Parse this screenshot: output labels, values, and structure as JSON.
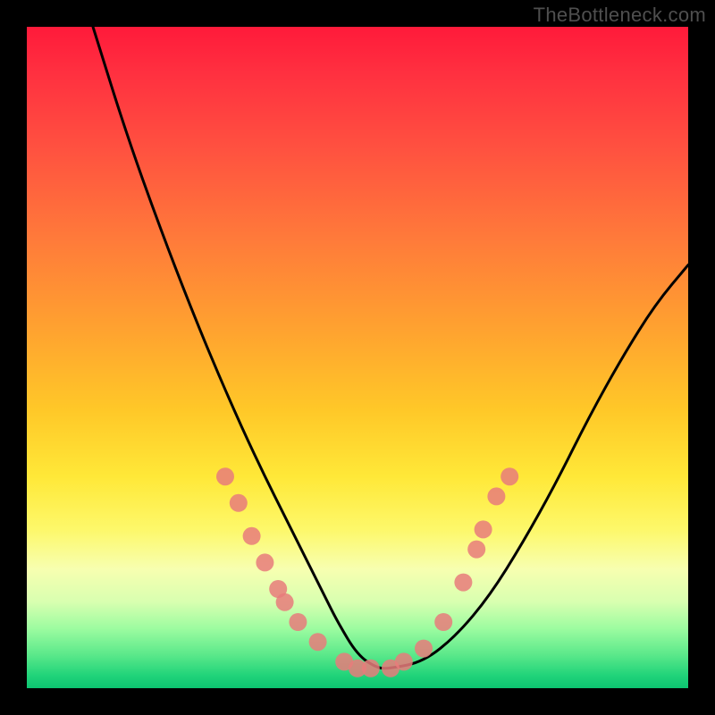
{
  "watermark": "TheBottleneck.com",
  "chart_data": {
    "type": "line",
    "title": "",
    "xlabel": "",
    "ylabel": "",
    "xlim": [
      0,
      100
    ],
    "ylim": [
      0,
      100
    ],
    "grid": false,
    "legend": false,
    "series": [
      {
        "name": "bottleneck-curve",
        "color": "#000000",
        "x": [
          10,
          15,
          20,
          25,
          30,
          35,
          40,
          45,
          47,
          50,
          53,
          55,
          60,
          65,
          70,
          75,
          80,
          85,
          90,
          95,
          100
        ],
        "y": [
          100,
          84,
          70,
          57,
          45,
          34,
          24,
          14,
          10,
          5,
          3,
          3,
          4,
          8,
          14,
          22,
          31,
          41,
          50,
          58,
          64
        ]
      }
    ],
    "markers": {
      "name": "highlighted-points",
      "color": "#e77b7b",
      "points": [
        {
          "x": 30,
          "y": 32
        },
        {
          "x": 32,
          "y": 28
        },
        {
          "x": 34,
          "y": 23
        },
        {
          "x": 36,
          "y": 19
        },
        {
          "x": 38,
          "y": 15
        },
        {
          "x": 39,
          "y": 13
        },
        {
          "x": 41,
          "y": 10
        },
        {
          "x": 44,
          "y": 7
        },
        {
          "x": 48,
          "y": 4
        },
        {
          "x": 50,
          "y": 3
        },
        {
          "x": 52,
          "y": 3
        },
        {
          "x": 55,
          "y": 3
        },
        {
          "x": 57,
          "y": 4
        },
        {
          "x": 60,
          "y": 6
        },
        {
          "x": 63,
          "y": 10
        },
        {
          "x": 66,
          "y": 16
        },
        {
          "x": 68,
          "y": 21
        },
        {
          "x": 69,
          "y": 24
        },
        {
          "x": 71,
          "y": 29
        },
        {
          "x": 73,
          "y": 32
        }
      ]
    },
    "background_gradient": {
      "top": "#ff1a3a",
      "mid": "#ffe838",
      "bottom": "#0cc471"
    }
  }
}
